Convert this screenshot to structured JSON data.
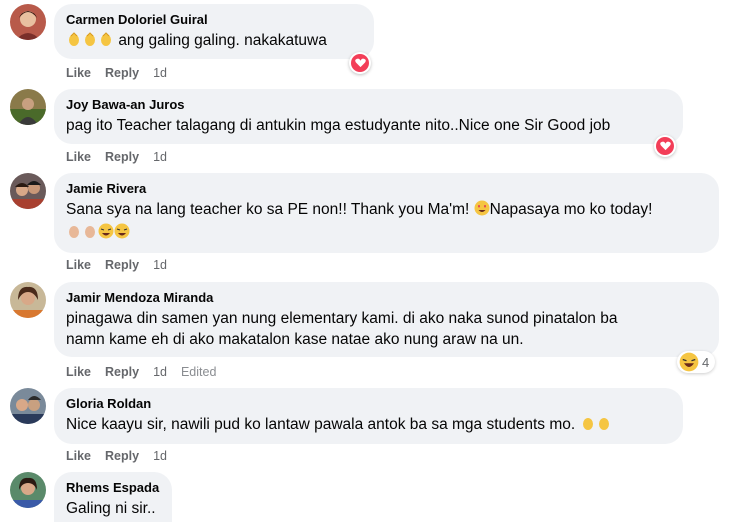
{
  "comments": [
    {
      "author": "Carmen Doloriel Guiral",
      "text": "ang galing galing. nakakatuwa",
      "like": "Like",
      "reply": "Reply",
      "time": "1d",
      "reaction": "heart-reaction-icon"
    },
    {
      "author": "Joy Bawa-an Juros",
      "text": "pag ito Teacher talagang di antukin mga estudyante nito..Nice one Sir Good job",
      "like": "Like",
      "reply": "Reply",
      "time": "1d",
      "reaction": "heart-reaction-icon"
    },
    {
      "author": "Jamie Rivera",
      "text_before": "Sana sya na lang teacher ko sa PE non!! Thank you Ma'm! ",
      "text_after": "Napasaya mo ko today!",
      "like": "Like",
      "reply": "Reply",
      "time": "1d"
    },
    {
      "author": "Jamir Mendoza Miranda",
      "text_line1": "pinagawa din samen yan nung elementary kami. di ako naka sunod pinatalon ba",
      "text_line2": "namn kame eh di ako makatalon kase natae ako nung araw na un.",
      "like": "Like",
      "reply": "Reply",
      "time": "1d",
      "edited": "Edited",
      "reaction_count": "4"
    },
    {
      "author": "Gloria Roldan",
      "text": "Nice kaayu sir, nawili pud ko lantaw pawala antok ba sa mga students mo.",
      "like": "Like",
      "reply": "Reply",
      "time": "1d"
    },
    {
      "author": "Rhems Espada",
      "text": "Galing ni sir.."
    }
  ],
  "colors": {
    "bubble": "#f0f2f5",
    "heart": "#f33e58",
    "meta": "#65676b"
  }
}
